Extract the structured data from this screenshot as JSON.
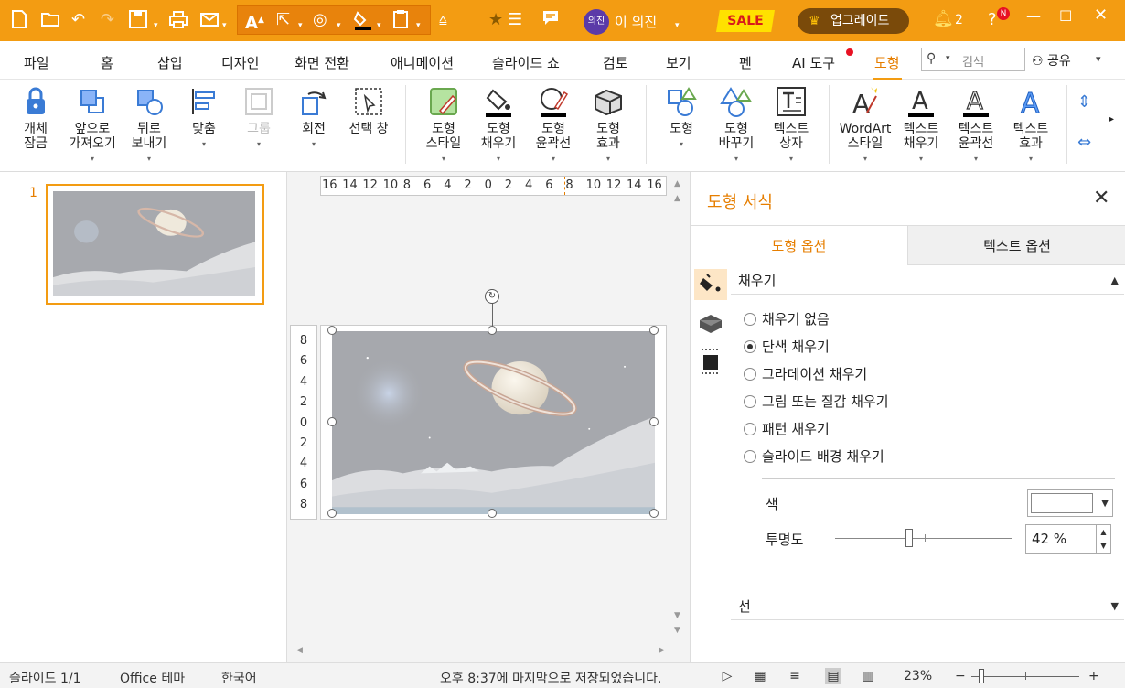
{
  "colors": {
    "accent": "#f39c12",
    "accent_dark": "#e67e00",
    "sale_bg": "#ffe100",
    "sale_fg": "#d81b1b",
    "upgrade_bg": "#7a4a0a"
  },
  "titlebar": {
    "quick_access": [
      "new-doc-icon",
      "open-folder-icon",
      "undo-icon",
      "redo-icon",
      "save-icon",
      "print-icon",
      "mail-icon",
      "font-size-icon",
      "select-pointer-icon",
      "shape-icon",
      "fill-color-icon",
      "paste-special-icon",
      "customize-icon"
    ],
    "user_avatar": "의진",
    "user_name": "이 의진",
    "sale": "SALE",
    "upgrade": "업그레이드",
    "notifications": "2",
    "help_badge": "N"
  },
  "menu": {
    "items": [
      "파일",
      "홈",
      "삽입",
      "디자인",
      "화면 전환",
      "애니메이션",
      "슬라이드 쇼",
      "검토",
      "보기",
      "펜",
      "AI 도구",
      "도형"
    ],
    "active": "도형",
    "search_placeholder": "검색",
    "share": "공유"
  },
  "ribbon": [
    {
      "l1": "개체",
      "l2": "잠금",
      "icon": "lock-icon"
    },
    {
      "l1": "앞으로",
      "l2": "가져오기",
      "icon": "bring-forward-icon",
      "dd": true
    },
    {
      "l1": "뒤로",
      "l2": "보내기",
      "icon": "send-backward-icon",
      "dd": true
    },
    {
      "l1": "맞춤",
      "icon": "align-icon",
      "dd": true
    },
    {
      "l1": "그룹",
      "icon": "group-icon",
      "dd": true,
      "disabled": true
    },
    {
      "l1": "회전",
      "icon": "rotate-icon",
      "dd": true
    },
    {
      "l1": "선택 창",
      "icon": "selection-pane-icon"
    },
    {
      "l1": "도형",
      "l2": "스타일",
      "icon": "shape-style-icon",
      "dd": true
    },
    {
      "l1": "도형",
      "l2": "채우기",
      "icon": "shape-fill-icon",
      "dd": true
    },
    {
      "l1": "도형",
      "l2": "윤곽선",
      "icon": "shape-outline-icon",
      "dd": true
    },
    {
      "l1": "도형",
      "l2": "효과",
      "icon": "shape-effect-icon",
      "dd": true
    },
    {
      "l1": "도형",
      "icon": "shapes-icon",
      "dd": true
    },
    {
      "l1": "도형",
      "l2": "바꾸기",
      "icon": "change-shape-icon",
      "dd": true
    },
    {
      "l1": "텍스트",
      "l2": "상자",
      "icon": "text-box-icon",
      "dd": true
    },
    {
      "l1": "WordArt",
      "l2": "스타일",
      "icon": "wordart-icon",
      "dd": true
    },
    {
      "l1": "텍스트",
      "l2": "채우기",
      "icon": "text-fill-icon",
      "dd": true
    },
    {
      "l1": "텍스트",
      "l2": "윤곽선",
      "icon": "text-outline-icon",
      "dd": true
    },
    {
      "l1": "텍스트",
      "l2": "효과",
      "icon": "text-effect-icon",
      "dd": true
    }
  ],
  "slides": {
    "numbers": [
      "1"
    ]
  },
  "ruler": {
    "h": [
      "16",
      "14",
      "12",
      "10",
      "8",
      "6",
      "4",
      "2",
      "0",
      "2",
      "4",
      "6",
      "8",
      "10",
      "12",
      "14",
      "16"
    ],
    "v": [
      "8",
      "6",
      "4",
      "2",
      "0",
      "2",
      "4",
      "6",
      "8"
    ]
  },
  "panel": {
    "title": "도형 서식",
    "tabs": [
      "도형 옵션",
      "텍스트 옵션"
    ],
    "fill_section": "채우기",
    "fill_options": [
      "채우기 없음",
      "단색 채우기",
      "그라데이션 채우기",
      "그림 또는 질감 채우기",
      "패턴 채우기",
      "슬라이드 배경 채우기"
    ],
    "fill_selected": 1,
    "color_label": "색",
    "color_value": "#ffffff",
    "transparency_label": "투명도",
    "transparency_value": "42 %",
    "transparency_level": 0.42,
    "line_section": "선"
  },
  "status": {
    "slide": "슬라이드 1/1",
    "theme": "Office 테마",
    "language": "한국어",
    "saved": "오후 8:37에 마지막으로 저장되었습니다.",
    "zoom": "23%",
    "zoom_minus": "−",
    "zoom_plus": "+"
  }
}
